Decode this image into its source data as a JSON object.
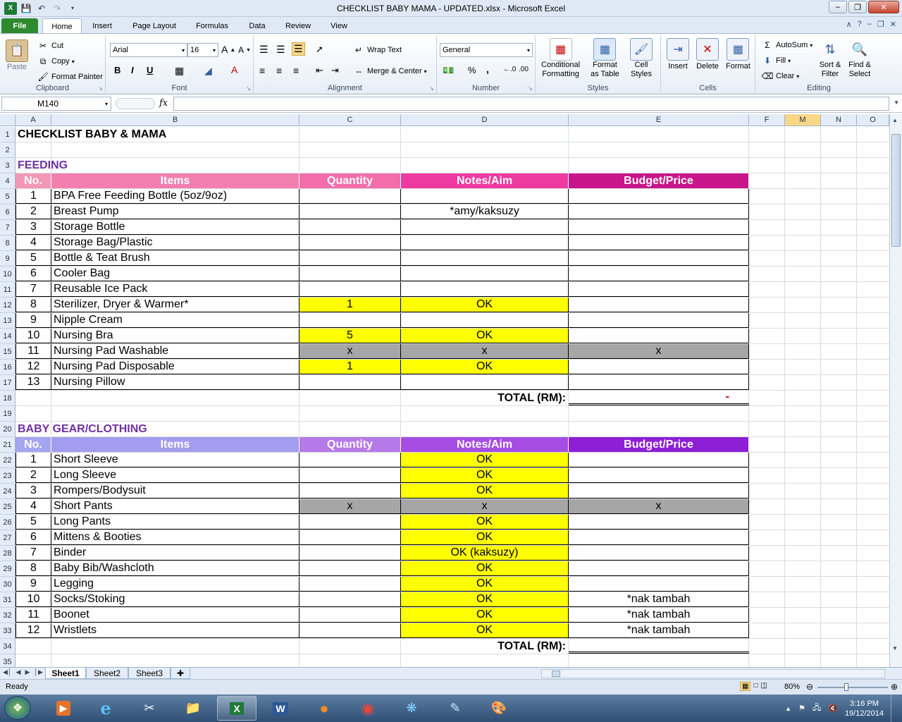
{
  "window": {
    "title": "CHECKLIST BABY MAMA - UPDATED.xlsx  -  Microsoft Excel",
    "qat": {
      "save_icon": "save-icon",
      "undo_icon": "undo-icon",
      "redo_icon": "redo-icon"
    }
  },
  "ribbon_tabs": [
    "File",
    "Home",
    "Insert",
    "Page Layout",
    "Formulas",
    "Data",
    "Review",
    "View"
  ],
  "ribbon": {
    "clipboard": {
      "paste": "Paste",
      "cut": "Cut",
      "copy": "Copy",
      "format_painter": "Format Painter",
      "label": "Clipboard"
    },
    "font": {
      "name": "Arial",
      "size": "16",
      "bold": "B",
      "italic": "I",
      "underline": "U",
      "label": "Font"
    },
    "alignment": {
      "wrap_text": "Wrap Text",
      "merge_center": "Merge & Center",
      "label": "Alignment"
    },
    "number": {
      "format": "General",
      "percent": "%",
      "comma": ",",
      "label": "Number"
    },
    "styles": {
      "conditional": "Conditional",
      "formatting": "Formatting",
      "format": "Format",
      "as_table": "as Table",
      "cell": "Cell",
      "styles": "Styles",
      "label": "Styles"
    },
    "cells": {
      "insert": "Insert",
      "delete": "Delete",
      "format": "Format",
      "label": "Cells"
    },
    "editing": {
      "autosum": "AutoSum",
      "fill": "Fill",
      "clear": "Clear",
      "sort1": "Sort &",
      "sort2": "Filter",
      "find1": "Find &",
      "find2": "Select",
      "label": "Editing"
    }
  },
  "formula_bar": {
    "name_box": "M140",
    "fx": "fx",
    "value": ""
  },
  "columns": [
    "A",
    "B",
    "C",
    "D",
    "E",
    "F",
    "M",
    "N",
    "O"
  ],
  "sheet": {
    "title": "CHECKLIST BABY & MAMA",
    "feeding": {
      "heading": "FEEDING",
      "headers": [
        "No.",
        "Items",
        "Quantity",
        "Notes/Aim",
        "Budget/Price"
      ],
      "rows": [
        {
          "no": "1",
          "item": "BPA Free Feeding Bottle (5oz/9oz)",
          "qty": "",
          "notes": "",
          "budget": ""
        },
        {
          "no": "2",
          "item": "Breast Pump",
          "qty": "",
          "notes": "*amy/kaksuzy",
          "budget": ""
        },
        {
          "no": "3",
          "item": "Storage Bottle",
          "qty": "",
          "notes": "",
          "budget": ""
        },
        {
          "no": "4",
          "item": "Storage Bag/Plastic",
          "qty": "",
          "notes": "",
          "budget": ""
        },
        {
          "no": "5",
          "item": "Bottle & Teat Brush",
          "qty": "",
          "notes": "",
          "budget": ""
        },
        {
          "no": "6",
          "item": "Cooler Bag",
          "qty": "",
          "notes": "",
          "budget": ""
        },
        {
          "no": "7",
          "item": "Reusable Ice Pack",
          "qty": "",
          "notes": "",
          "budget": ""
        },
        {
          "no": "8",
          "item": "Sterilizer, Dryer & Warmer*",
          "qty": "1",
          "notes": "OK",
          "budget": ""
        },
        {
          "no": "9",
          "item": "Nipple Cream",
          "qty": "",
          "notes": "",
          "budget": ""
        },
        {
          "no": "10",
          "item": "Nursing Bra",
          "qty": "5",
          "notes": "OK",
          "budget": ""
        },
        {
          "no": "11",
          "item": "Nursing Pad Washable",
          "qty": "x",
          "notes": "x",
          "budget": "x"
        },
        {
          "no": "12",
          "item": "Nursing Pad Disposable",
          "qty": "1",
          "notes": "OK",
          "budget": ""
        },
        {
          "no": "13",
          "item": "Nursing Pillow",
          "qty": "",
          "notes": "",
          "budget": ""
        }
      ],
      "total_label": "TOTAL (RM):",
      "total_value": "-"
    },
    "gear": {
      "heading": "BABY GEAR/CLOTHING",
      "headers": [
        "No.",
        "Items",
        "Quantity",
        "Notes/Aim",
        "Budget/Price"
      ],
      "rows": [
        {
          "no": "1",
          "item": "Short Sleeve",
          "qty": "",
          "notes": "OK",
          "budget": ""
        },
        {
          "no": "2",
          "item": "Long Sleeve",
          "qty": "",
          "notes": "OK",
          "budget": ""
        },
        {
          "no": "3",
          "item": "Rompers/Bodysuit",
          "qty": "",
          "notes": "OK",
          "budget": ""
        },
        {
          "no": "4",
          "item": "Short Pants",
          "qty": "x",
          "notes": "x",
          "budget": "x"
        },
        {
          "no": "5",
          "item": "Long Pants",
          "qty": "",
          "notes": "OK",
          "budget": ""
        },
        {
          "no": "6",
          "item": "Mittens & Booties",
          "qty": "",
          "notes": "OK",
          "budget": ""
        },
        {
          "no": "7",
          "item": "Binder",
          "qty": "",
          "notes": "OK (kaksuzy)",
          "budget": ""
        },
        {
          "no": "8",
          "item": "Baby Bib/Washcloth",
          "qty": "",
          "notes": "OK",
          "budget": ""
        },
        {
          "no": "9",
          "item": "Legging",
          "qty": "",
          "notes": "OK",
          "budget": ""
        },
        {
          "no": "10",
          "item": "Socks/Stoking",
          "qty": "",
          "notes": "OK",
          "budget": "*nak tambah"
        },
        {
          "no": "11",
          "item": "Boonet",
          "qty": "",
          "notes": "OK",
          "budget": "*nak tambah"
        },
        {
          "no": "12",
          "item": "Wristlets",
          "qty": "",
          "notes": "OK",
          "budget": "*nak tambah"
        }
      ],
      "total_label": "TOTAL (RM):"
    }
  },
  "sheet_tabs": [
    "Sheet1",
    "Sheet2",
    "Sheet3"
  ],
  "status": {
    "ready": "Ready",
    "zoom": "80%"
  },
  "taskbar": {
    "time": "3:16 PM",
    "date": "19/12/2014"
  },
  "colors": {
    "feeding_no": "#f497b6",
    "feeding_items": "#f37fb0",
    "feeding_qty": "#f46dab",
    "feeding_notes": "#ee3aa0",
    "feeding_budget": "#c9158a",
    "gear_no": "#a6a5f0",
    "gear_items": "#a39df0",
    "gear_qty": "#b67ae8",
    "gear_notes": "#a64de3",
    "gear_budget": "#8d1fd6",
    "yellow": "#ffff00",
    "gray": "#a6a6a6",
    "heading": "#7030a0"
  }
}
